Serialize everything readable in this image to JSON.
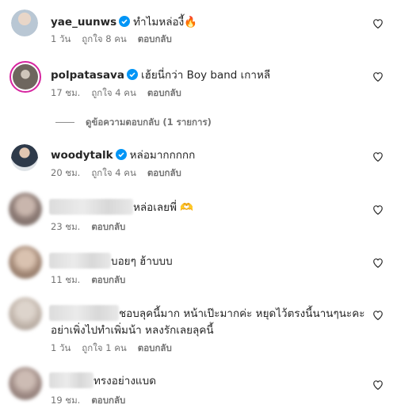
{
  "comments": [
    {
      "username": "yae_uunws",
      "verified": true,
      "text": "ทำไมหล่องี้🔥",
      "time": "1 วัน",
      "likes": "ถูกใจ 8 คน",
      "reply": "ตอบกลับ",
      "avatar_color": "#a7b7c6"
    },
    {
      "username": "polpatasava",
      "verified": true,
      "text": "เฮ้ยนี่กว่า Boy band เกาหลี",
      "time": "17 ชม.",
      "likes": "ถูกใจ 4 คน",
      "reply": "ตอบกลับ",
      "avatar_color": "#6e665e"
    },
    {
      "username": "woodytalk",
      "verified": true,
      "text": "หล่อมากกกกก",
      "time": "20 ชม.",
      "likes": "ถูกใจ 4 คน",
      "reply": "ตอบกลับ",
      "avatar_color": "#2e3a4a"
    },
    {
      "username": "",
      "text": "หล่อเลยพี่ 🫶",
      "time": "23 ชม.",
      "likes": "",
      "reply": "ตอบกลับ",
      "avatar_color": "#9c8c86"
    },
    {
      "username": "",
      "text": "บอยๆ ฮ้าบบบ",
      "time": "11 ชม.",
      "likes": "",
      "reply": "ตอบกลับ",
      "avatar_color": "#a58a78"
    },
    {
      "username": "",
      "text": "ชอบลุคนี้มาก หน้าเป๊ะมากค่ะ หยุดไว้ตรงนี้นานๆนะคะ",
      "text2": "อย่าเพิ่งไปทำเพิ่มน้า หลงรักเลยลุคนี้",
      "time": "1 วัน",
      "likes": "ถูกใจ 1 คน",
      "reply": "ตอบกลับ",
      "avatar_color": "#c3b7ad"
    },
    {
      "username": "",
      "text": "ทรงอย่างแบด",
      "time": "19 ชม.",
      "likes": "",
      "reply": "ตอบกลับ",
      "avatar_color": "#a08c86"
    }
  ],
  "view_replies": "ดูข้อความตอบกลับ (1 รายการ)",
  "colors": {
    "verified": "#0095f6",
    "muted": "#737373"
  }
}
